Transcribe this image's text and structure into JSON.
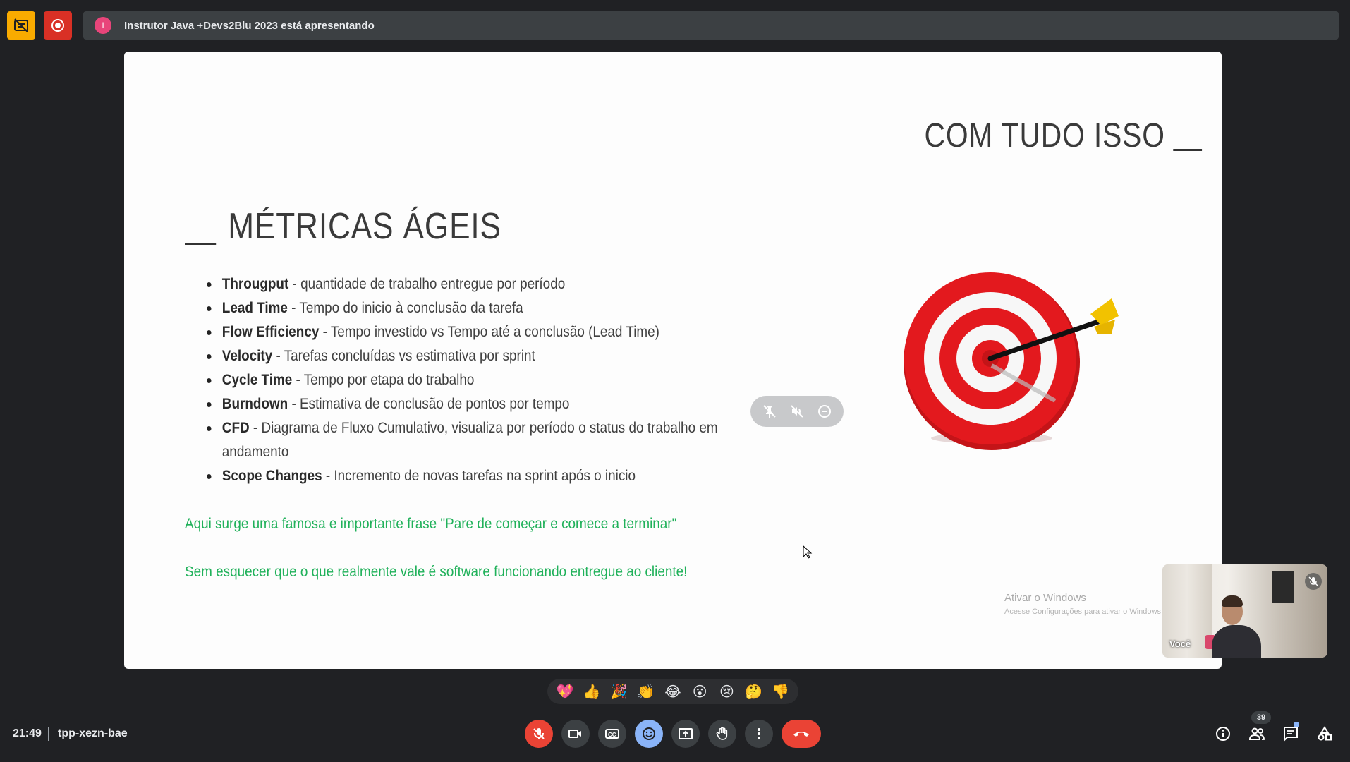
{
  "topbar": {
    "presenter_initial": "I",
    "presenting_text": "Instrutor Java +Devs2Blu 2023 está apresentando"
  },
  "slide": {
    "title": "COM TUDO ISSO",
    "section_title": "MÉTRICAS ÁGEIS",
    "metrics": [
      {
        "term": "Througput",
        "desc": " - quantidade de trabalho entregue por período"
      },
      {
        "term": "Lead Time",
        "desc": " - Tempo do inicio à conclusão da tarefa"
      },
      {
        "term": "Flow Efficiency",
        "desc": " - Tempo investido vs Tempo até a conclusão (Lead Time)"
      },
      {
        "term": "Velocity",
        "desc": " - Tarefas concluídas vs estimativa por sprint"
      },
      {
        "term": "Cycle Time",
        "desc": " - Tempo por etapa do trabalho"
      },
      {
        "term": "Burndown",
        "desc": " - Estimativa de conclusão de pontos por tempo"
      },
      {
        "term": "CFD",
        "desc": " - Diagrama de Fluxo Cumulativo, visualiza por período o status do trabalho em andamento"
      },
      {
        "term": "Scope Changes",
        "desc": " - Incremento de novas tarefas na sprint após o inicio"
      }
    ],
    "quote1": "Aqui surge uma famosa e importante frase \"Pare de começar e comece a terminar\"",
    "quote2": "Sem esquecer que o que realmente vale é software funcionando entregue ao cliente!",
    "watermark_title": "Ativar o Windows",
    "watermark_sub": "Acesse Configurações para ativar o Windows."
  },
  "self_view": {
    "label": "Você"
  },
  "reactions": [
    "💖",
    "👍",
    "🎉",
    "👏",
    "😂",
    "😮",
    "😢",
    "🤔",
    "👎"
  ],
  "bottom": {
    "time": "21:49",
    "meeting_code": "tpp-xezn-bae",
    "participants_count": "39"
  },
  "colors": {
    "background": "#202124",
    "accent_red": "#ea4335",
    "accent_blue": "#8ab4f8",
    "green_text": "#20b15a"
  }
}
